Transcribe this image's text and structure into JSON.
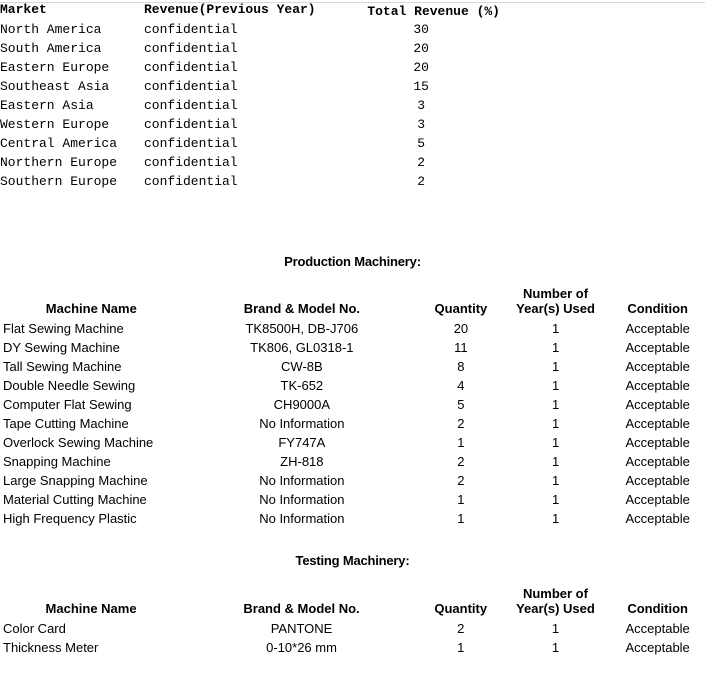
{
  "market_table": {
    "headers": {
      "market": "Market",
      "revenue_previous_year": "Revenue(Previous Year)",
      "total_revenue_line1": "Total",
      "total_revenue_line2": "Revenue",
      "total_revenue_line3": "(%)"
    },
    "rows": [
      {
        "market": "North America",
        "revenue": "confidential",
        "total_revenue_pct": "30"
      },
      {
        "market": "South America",
        "revenue": "confidential",
        "total_revenue_pct": "20"
      },
      {
        "market": "Eastern Europe",
        "revenue": "confidential",
        "total_revenue_pct": "20"
      },
      {
        "market": "Southeast Asia",
        "revenue": "confidential",
        "total_revenue_pct": "15"
      },
      {
        "market": "Eastern Asia",
        "revenue": "confidential",
        "total_revenue_pct": "3"
      },
      {
        "market": "Western Europe",
        "revenue": "confidential",
        "total_revenue_pct": "3"
      },
      {
        "market": "Central America",
        "revenue": "confidential",
        "total_revenue_pct": "5"
      },
      {
        "market": "Northern Europe",
        "revenue": "confidential",
        "total_revenue_pct": "2"
      },
      {
        "market": "Southern Europe",
        "revenue": "confidential",
        "total_revenue_pct": "2"
      }
    ]
  },
  "production": {
    "caption": "Production Machinery:",
    "headers": {
      "machine_name": "Machine Name",
      "brand_model": "Brand & Model No.",
      "quantity": "Quantity",
      "years_used_line1": "Number of",
      "years_used_line2": "Year(s) Used",
      "condition": "Condition"
    },
    "rows": [
      {
        "name": "Flat Sewing Machine",
        "model": "TK8500H, DB-J706",
        "qty": "20",
        "years": "1",
        "condition": "Acceptable"
      },
      {
        "name": "DY Sewing Machine",
        "model": "TK806, GL0318-1",
        "qty": "11",
        "years": "1",
        "condition": "Acceptable"
      },
      {
        "name": "Tall Sewing Machine",
        "model": "CW-8B",
        "qty": "8",
        "years": "1",
        "condition": "Acceptable"
      },
      {
        "name": "Double Needle Sewing",
        "model": "TK-652",
        "qty": "4",
        "years": "1",
        "condition": "Acceptable"
      },
      {
        "name": "Computer Flat Sewing",
        "model": "CH9000A",
        "qty": "5",
        "years": "1",
        "condition": "Acceptable"
      },
      {
        "name": "Tape Cutting Machine",
        "model": "No Information",
        "qty": "2",
        "years": "1",
        "condition": "Acceptable"
      },
      {
        "name": "Overlock Sewing Machine",
        "model": "FY747A",
        "qty": "1",
        "years": "1",
        "condition": "Acceptable"
      },
      {
        "name": "Snapping Machine",
        "model": "ZH-818",
        "qty": "2",
        "years": "1",
        "condition": "Acceptable"
      },
      {
        "name": "Large Snapping Machine",
        "model": "No Information",
        "qty": "2",
        "years": "1",
        "condition": "Acceptable"
      },
      {
        "name": "Material Cutting Machine",
        "model": "No Information",
        "qty": "1",
        "years": "1",
        "condition": "Acceptable"
      },
      {
        "name": "High Frequency Plastic",
        "model": "No Information",
        "qty": "1",
        "years": "1",
        "condition": "Acceptable"
      }
    ]
  },
  "testing": {
    "caption": "Testing Machinery:",
    "headers": {
      "machine_name": "Machine Name",
      "brand_model": "Brand & Model No.",
      "quantity": "Quantity",
      "years_used_line1": "Number of",
      "years_used_line2": "Year(s) Used",
      "condition": "Condition"
    },
    "rows": [
      {
        "name": "Color Card",
        "model": "PANTONE",
        "qty": "2",
        "years": "1",
        "condition": "Acceptable"
      },
      {
        "name": "Thickness Meter",
        "model": "0-10*26 mm",
        "qty": "1",
        "years": "1",
        "condition": "Acceptable"
      }
    ]
  },
  "colors": {
    "text": "#000000",
    "background": "#ffffff",
    "rule": "#d8d8d8"
  }
}
